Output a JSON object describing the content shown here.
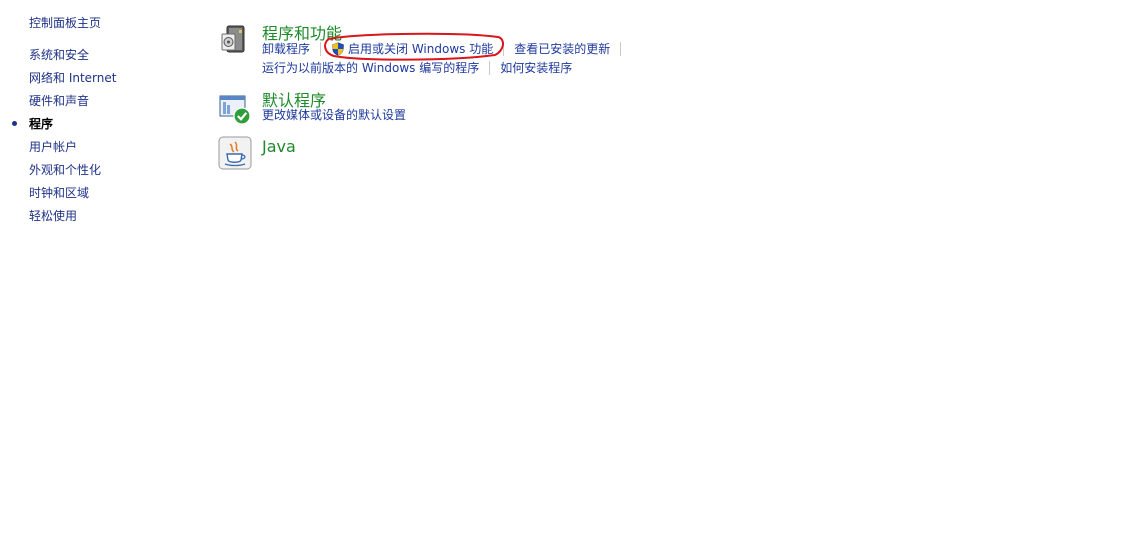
{
  "sidebar": {
    "home_label": "控制面板主页",
    "items": [
      {
        "label": "系统和安全",
        "active": false
      },
      {
        "label": "网络和 Internet",
        "active": false
      },
      {
        "label": "硬件和声音",
        "active": false
      },
      {
        "label": "程序",
        "active": true
      },
      {
        "label": "用户帐户",
        "active": false
      },
      {
        "label": "外观和个性化",
        "active": false
      },
      {
        "label": "时钟和区域",
        "active": false
      },
      {
        "label": "轻松使用",
        "active": false
      }
    ]
  },
  "sections": [
    {
      "title": "程序和功能",
      "icon": "programs-features-icon",
      "links_row1": [
        "卸载程序",
        "启用或关闭 Windows 功能",
        "查看已安装的更新"
      ],
      "links_row2": [
        "运行为以前版本的 Windows 编写的程序",
        "如何安装程序"
      ]
    },
    {
      "title": "默认程序",
      "icon": "default-programs-icon",
      "links_row1": [
        "更改媒体或设备的默认设置"
      ]
    },
    {
      "title": "Java",
      "icon": "java-icon"
    }
  ],
  "colors": {
    "title_green": "#1e8a2a",
    "link_blue": "#1e3a9c",
    "annotation_red": "#d8161b"
  }
}
